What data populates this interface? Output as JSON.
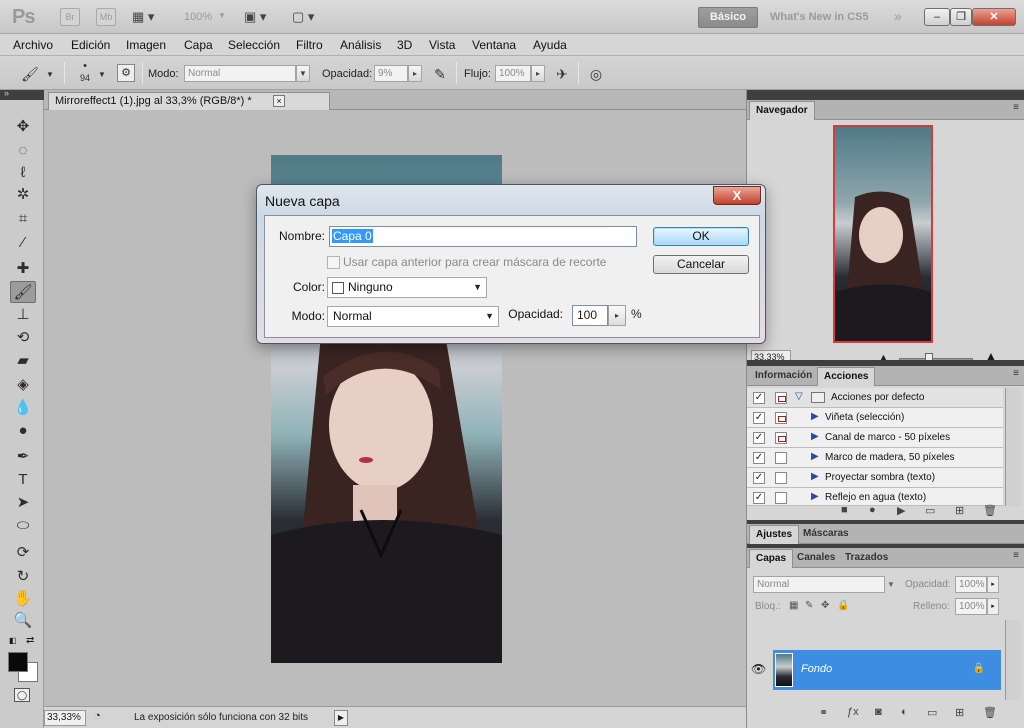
{
  "app": {
    "logo": "Ps",
    "bridge": "Br",
    "minibridge": "Mb",
    "zoom": "100%",
    "workspace_active": "Básico",
    "workspace_other": "What's New in CS5",
    "more": "»"
  },
  "menu": [
    "Archivo",
    "Edición",
    "Imagen",
    "Capa",
    "Selección",
    "Filtro",
    "Análisis",
    "3D",
    "Vista",
    "Ventana",
    "Ayuda"
  ],
  "options": {
    "brush_size": "94",
    "mode_label": "Modo:",
    "mode_value": "Normal",
    "opacity_label": "Opacidad:",
    "opacity_value": "9%",
    "flow_label": "Flujo:",
    "flow_value": "100%"
  },
  "document": {
    "tab_title": "Mirroreffect1 (1).jpg al 33,3% (RGB/8*) *",
    "close": "×"
  },
  "status": {
    "zoom": "33,33%",
    "message": "La exposición sólo funciona con 32 bits"
  },
  "navigator": {
    "tab": "Navegador",
    "zoom": "33,33%"
  },
  "actions": {
    "tab_info": "Información",
    "tab_actions": "Acciones",
    "set_name": "Acciones por defecto",
    "items": [
      {
        "name": "Viñeta (selección)",
        "dialog": true
      },
      {
        "name": "Canal de marco - 50 píxeles",
        "dialog": true
      },
      {
        "name": "Marco de madera, 50 píxeles",
        "dialog": false
      },
      {
        "name": "Proyectar sombra (texto)",
        "dialog": false
      },
      {
        "name": "Reflejo en agua (texto)",
        "dialog": false
      }
    ]
  },
  "adjust": {
    "tab_adjust": "Ajustes",
    "tab_masks": "Máscaras"
  },
  "layers": {
    "tab_layers": "Capas",
    "tab_channels": "Canales",
    "tab_paths": "Trazados",
    "blend": "Normal",
    "opacity_label": "Opacidad:",
    "opacity_value": "100%",
    "lock_label": "Bloq.:",
    "fill_label": "Relleno:",
    "fill_value": "100%",
    "layer_name": "Fondo"
  },
  "dialog": {
    "title": "Nueva capa",
    "close": "X",
    "name_label": "Nombre:",
    "name_value": "Capa 0",
    "clip_label": "Usar capa anterior para crear máscara de recorte",
    "color_label": "Color:",
    "color_value": "Ninguno",
    "mode_label": "Modo:",
    "mode_value": "Normal",
    "opacity_label": "Opacidad:",
    "opacity_value": "100",
    "percent": "%",
    "ok": "OK",
    "cancel": "Cancelar"
  }
}
